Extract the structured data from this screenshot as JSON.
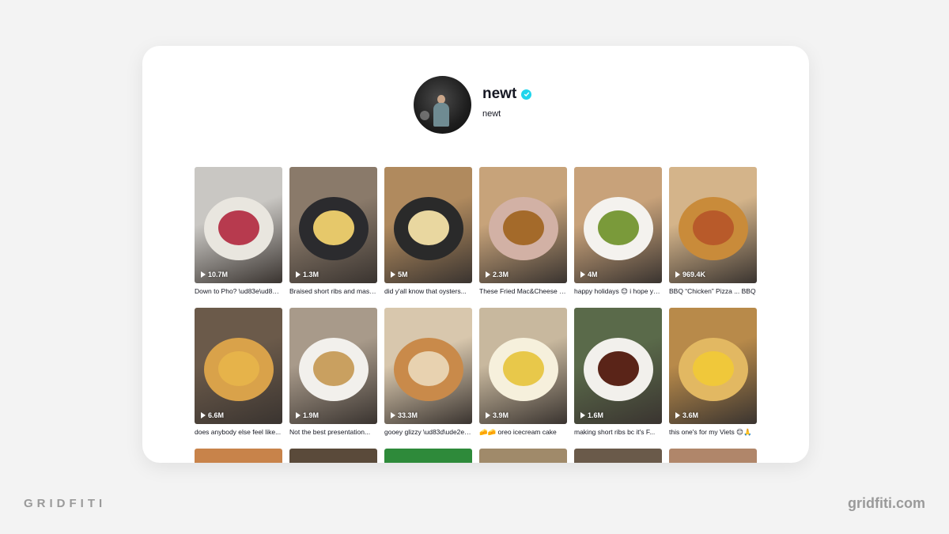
{
  "profile": {
    "username": "newt",
    "nickname": "newt",
    "verified": true
  },
  "videos": [
    {
      "plays": "10.7M",
      "caption": "Down to Pho? \\ud83e\\ud83d\\udc4f",
      "colors": [
        "#c9c7c3",
        "#e9e6df",
        "#b73a4e"
      ]
    },
    {
      "plays": "1.3M",
      "caption": "Braised short ribs and mashed potatoes",
      "colors": [
        "#8a7a6a",
        "#2b2b2e",
        "#e6c86a"
      ]
    },
    {
      "plays": "5M",
      "caption": "did y'all know that oysters...",
      "colors": [
        "#b08a5e",
        "#2a2a2a",
        "#e9d7a0"
      ]
    },
    {
      "plays": "2.3M",
      "caption": "These Fried Mac&Cheese Balls",
      "colors": [
        "#c7a37a",
        "#d2b1a5",
        "#a46a2a"
      ]
    },
    {
      "plays": "4M",
      "caption": "happy holidays 😊 i hope you all",
      "colors": [
        "#c8a27a",
        "#f4f2ee",
        "#7a9a3a"
      ]
    },
    {
      "plays": "969.4K",
      "caption": "BBQ “Chicken” Pizza ... BBQ",
      "colors": [
        "#d4b48a",
        "#c98b3a",
        "#b85a2a"
      ]
    },
    {
      "plays": "6.6M",
      "caption": "does anybody else feel like...",
      "colors": [
        "#6b5a4a",
        "#d9a24a",
        "#e6b34a"
      ]
    },
    {
      "plays": "1.9M",
      "caption": "Not the best presentation...",
      "colors": [
        "#a89a8a",
        "#f2f0ec",
        "#c9a060"
      ]
    },
    {
      "plays": "33.3M",
      "caption": "gooey glizzy \\ud83d\\ude2e\\udf2d",
      "colors": [
        "#d8c7ad",
        "#c98a4a",
        "#e8d2b0"
      ]
    },
    {
      "plays": "3.9M",
      "caption": "🧀🧀 oreo icecream cake",
      "colors": [
        "#c8b89e",
        "#f6f0dc",
        "#e8c84a"
      ]
    },
    {
      "plays": "1.6M",
      "caption": "making short ribs bc it's F...",
      "colors": [
        "#5a6a4a",
        "#f2f0ec",
        "#5a2418"
      ]
    },
    {
      "plays": "3.6M",
      "caption": "this one's for my Viets 😊🙏",
      "colors": [
        "#b88a4a",
        "#e2b862",
        "#f0c83a"
      ]
    }
  ],
  "partial_row_colors": [
    "#c8834a",
    "#5a4a3a",
    "#2e8a3a",
    "#a08a6a",
    "#6a5a4a",
    "#b0866a"
  ],
  "brand": {
    "left": "GRIDFITI",
    "right": "gridfiti.com"
  }
}
